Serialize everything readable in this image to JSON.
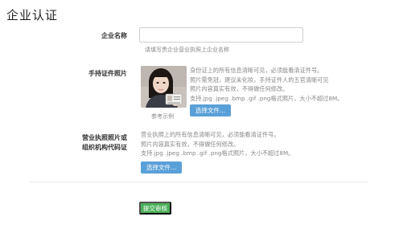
{
  "page": {
    "title": "企业认证"
  },
  "form": {
    "company_name": {
      "label": "企业名称",
      "value": "",
      "hint": "请填写贵企业营业执照上企业名称"
    },
    "id_photo": {
      "label": "手持证件照片",
      "sample_caption": "参考示例",
      "desc_lines": [
        "身份证上的所有信息清晰可见，必须能看清证件号。",
        "照片需免冠，建议未化妆，手持证件人的五官清晰可见",
        "照片内容真实有效，不得做任何修改。",
        "支持.jpg .jpeg .bmp .gif .png格式照片，大小不超过8M。"
      ],
      "button_label": "选择文件..."
    },
    "business_license": {
      "label_line1": "营业执照照片或",
      "label_line2": "组织机构代码证",
      "desc_lines": [
        "营业执照上的所有信息清晰可见，必须能看清证件号。",
        "照片内容真实有效，不得做任何修改。",
        "支持.jpg .jpeg .bmp .gif .png格式照片，大小不超过8M。"
      ],
      "button_label": "选择文件..."
    },
    "submit_label": "提交审核"
  },
  "colors": {
    "file_button": "#5aa0d8",
    "submit_button": "#4cb05a"
  },
  "icons": {
    "sample_photo": "person-holding-id-photo"
  }
}
